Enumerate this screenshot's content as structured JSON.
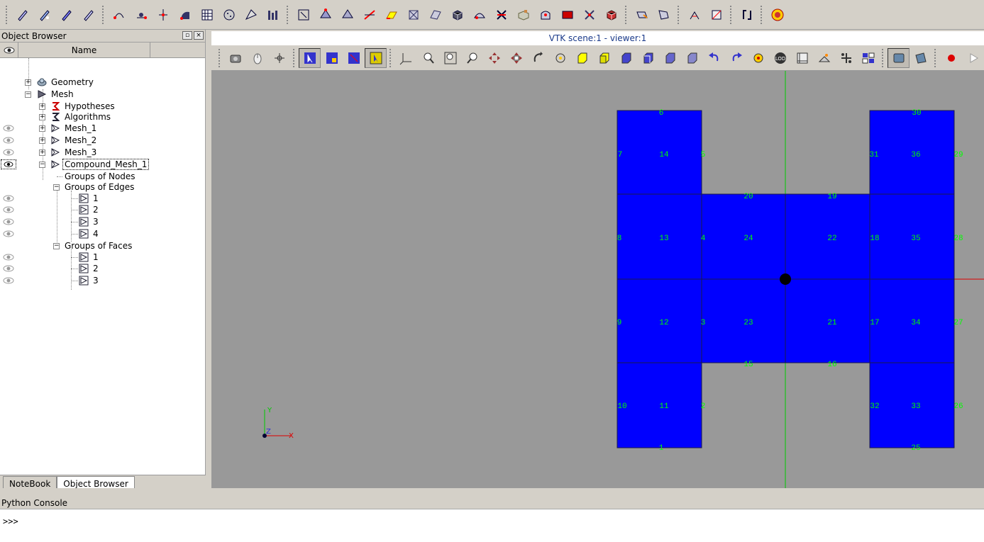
{
  "object_browser": {
    "title": "Object Browser",
    "name_header": "Name",
    "tree": [
      {
        "label": "Geometry",
        "icon": "geometry-icon"
      },
      {
        "label": "Mesh",
        "icon": "mesh-component-icon"
      },
      {
        "label": "Hypotheses",
        "icon": "hypotheses-icon"
      },
      {
        "label": "Algorithms",
        "icon": "algorithms-icon"
      },
      {
        "label": "Mesh_1",
        "icon": "mesh-icon"
      },
      {
        "label": "Mesh_2",
        "icon": "mesh-icon"
      },
      {
        "label": "Mesh_3",
        "icon": "mesh-icon"
      },
      {
        "label": "Compound_Mesh_1",
        "icon": "mesh-icon"
      },
      {
        "label": "Groups of Nodes"
      },
      {
        "label": "Groups of Edges"
      },
      {
        "label": "1",
        "icon": "group-icon"
      },
      {
        "label": "2",
        "icon": "group-icon"
      },
      {
        "label": "3",
        "icon": "group-icon"
      },
      {
        "label": "4",
        "icon": "group-icon"
      },
      {
        "label": "Groups of Faces"
      },
      {
        "label": "1",
        "icon": "group-icon"
      },
      {
        "label": "2",
        "icon": "group-icon"
      },
      {
        "label": "3",
        "icon": "group-icon"
      }
    ],
    "tabs": [
      "NoteBook",
      "Object Browser"
    ]
  },
  "viewer": {
    "title": "VTK scene:1 - viewer:1",
    "background_color": "#999999",
    "mesh_color": "#0000ff",
    "label_color": "#00ff00"
  },
  "mesh_labels": [
    "6",
    "14",
    "31",
    "36",
    "7",
    "5",
    "30",
    "29",
    "20",
    "19",
    "8",
    "13",
    "4",
    "24",
    "22",
    "18",
    "35",
    "28",
    "9",
    "12",
    "3",
    "23",
    "21",
    "17",
    "34",
    "27",
    "15",
    "16",
    "10",
    "11",
    "2",
    "32",
    "33",
    "26",
    "1",
    "25"
  ],
  "console": {
    "title": "Python Console",
    "prompt": ">>>"
  },
  "toolbar_icons": [
    "pencil-icon",
    "pencil-icon",
    "pencil-icon",
    "pencil-icon",
    "node-icon",
    "node-icon",
    "node-icon",
    "node-icon",
    "grid-icon",
    "sphere-icon",
    "polyhedron-icon",
    "bars-icon",
    "select-icon",
    "tetra-icon",
    "tetra-icon",
    "edge-icon",
    "face-icon",
    "mesh-ops-icon",
    "mesh-ops-icon",
    "cube-icon",
    "extrude-icon",
    "cut-icon",
    "box-icon",
    "revolve-icon",
    "square-icon",
    "split-icon",
    "cube-red-icon",
    "selection-icon",
    "selection-icon",
    "measure-icon",
    "measure-icon",
    "scale-icon",
    "refresh-icon"
  ],
  "viewer_icons": [
    "camera-icon",
    "mouse-icon",
    "rotation-point-icon",
    "select-icon",
    "select-icon",
    "select-icon",
    "select-icon",
    "axes-icon",
    "zoom-icon",
    "zoom-icon",
    "zoom-icon",
    "pan-icon",
    "global-pan-icon",
    "rotate-icon",
    "spin-icon",
    "cube-view-icon",
    "cube-view-icon",
    "cube-view-icon",
    "cube-view-icon",
    "cube-view-icon",
    "cube-view-icon",
    "undo-icon",
    "redo-icon",
    "reset-icon",
    "lod-icon",
    "graduated-axes-icon",
    "scaling-icon",
    "clipping-icon",
    "view-mode-icon",
    "projection-icon",
    "projection-icon",
    "record-icon",
    "play-icon"
  ]
}
